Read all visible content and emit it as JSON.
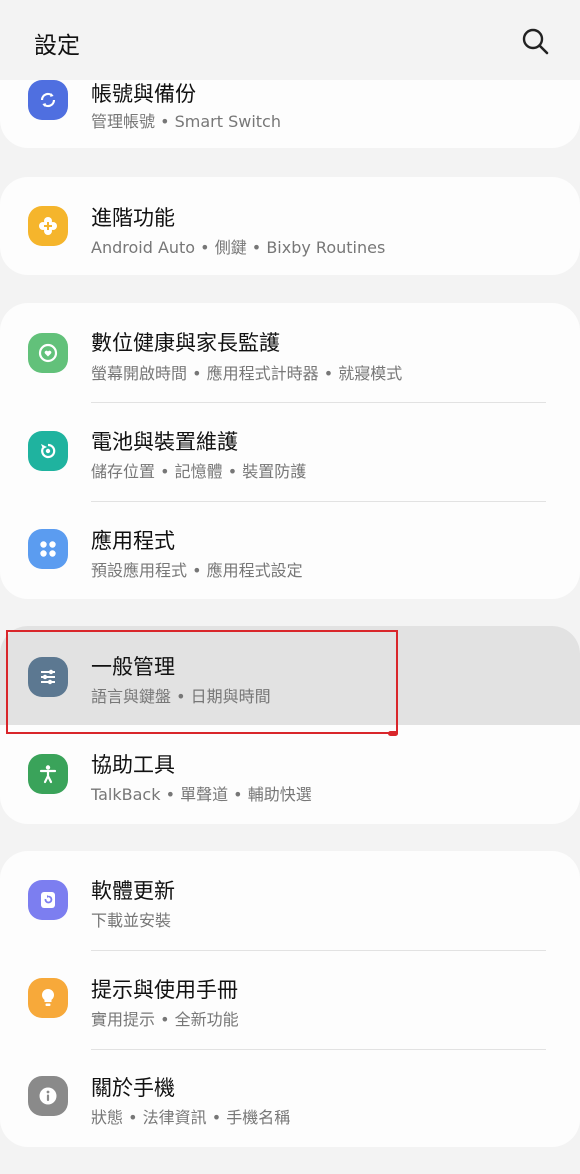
{
  "header": {
    "title": "設定",
    "search_icon": "search-icon"
  },
  "cards": [
    {
      "items": [
        {
          "name": "accounts-backup",
          "label": "帳號與備份",
          "sub": "管理帳號 • Smart Switch",
          "icon": "sync-icon",
          "color": "#4f6fe0"
        }
      ]
    },
    {
      "items": [
        {
          "name": "advanced-features",
          "label": "進階功能",
          "sub": "Android Auto • 側鍵 • Bixby Routines",
          "icon": "plus-flower-icon",
          "color": "#f5b52c"
        }
      ]
    },
    {
      "items": [
        {
          "name": "digital-wellbeing",
          "label": "數位健康與家長監護",
          "sub": "螢幕開啟時間 • 應用程式計時器 • 就寢模式",
          "icon": "heart-ring-icon",
          "color": "#62c17a"
        },
        {
          "name": "battery-device-care",
          "label": "電池與裝置維護",
          "sub": "儲存位置 • 記憶體 • 裝置防護",
          "icon": "refresh-ring-icon",
          "color": "#1fb39f"
        },
        {
          "name": "apps",
          "label": "應用程式",
          "sub": "預設應用程式 • 應用程式設定",
          "icon": "four-dots-icon",
          "color": "#5b9cf0"
        }
      ]
    },
    {
      "items": [
        {
          "name": "general-management",
          "label": "一般管理",
          "sub": "語言與鍵盤 • 日期與時間",
          "icon": "sliders-icon",
          "color": "#5c7891"
        },
        {
          "name": "accessibility",
          "label": "協助工具",
          "sub": "TalkBack • 單聲道 • 輔助快選",
          "icon": "accessibility-icon",
          "color": "#3aa35a"
        }
      ]
    },
    {
      "items": [
        {
          "name": "software-update",
          "label": "軟體更新",
          "sub": "下載並安裝",
          "icon": "update-icon",
          "color": "#7c7ef0"
        },
        {
          "name": "tips-manual",
          "label": "提示與使用手冊",
          "sub": "實用提示 • 全新功能",
          "icon": "lightbulb-icon",
          "color": "#f7a93a"
        },
        {
          "name": "about-phone",
          "label": "關於手機",
          "sub": "狀態 • 法律資訊 • 手機名稱",
          "icon": "info-icon",
          "color": "#8a8a8a"
        }
      ]
    }
  ]
}
